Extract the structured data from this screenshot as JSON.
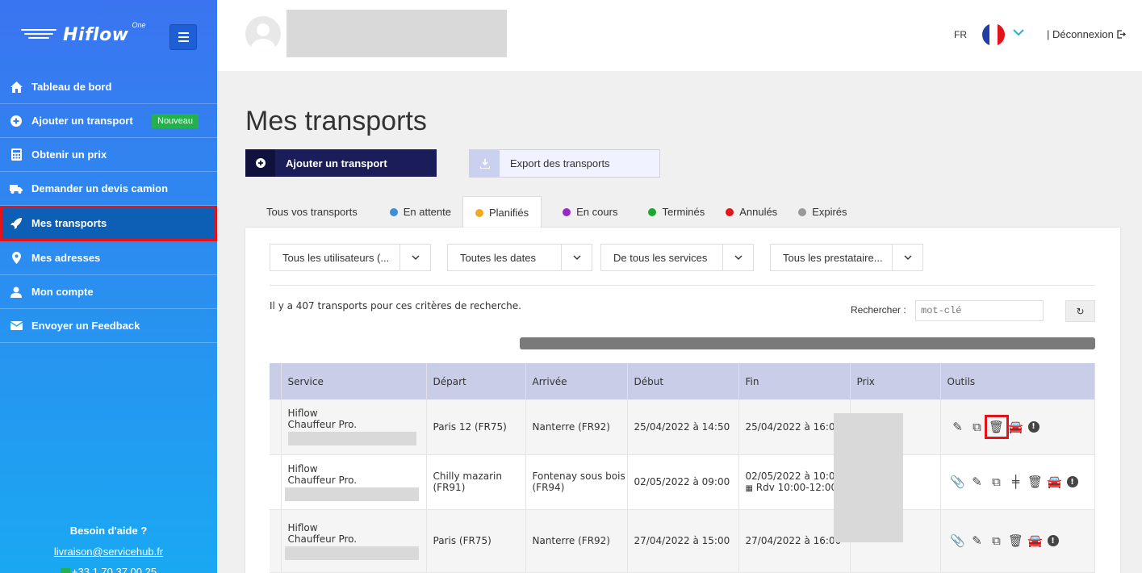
{
  "sidebar": {
    "logo_text": "Hiflow",
    "logo_sup": "One",
    "items": [
      {
        "label": "Tableau de bord",
        "icon": "home-icon"
      },
      {
        "label": "Ajouter un transport",
        "icon": "plus-circle-icon",
        "badge": "Nouveau"
      },
      {
        "label": "Obtenir un prix",
        "icon": "calculator-icon"
      },
      {
        "label": "Demander un devis camion",
        "icon": "truck-icon"
      },
      {
        "label": "Mes transports",
        "icon": "rocket-icon",
        "active": true
      },
      {
        "label": "Mes adresses",
        "icon": "map-pin-icon"
      },
      {
        "label": "Mon compte",
        "icon": "user-icon"
      },
      {
        "label": "Envoyer un Feedback",
        "icon": "envelope-icon"
      }
    ],
    "help_title": "Besoin d'aide ?",
    "help_email": "livraison@servicehub.fr",
    "help_phone": "+33 1 70 37 00 25"
  },
  "header": {
    "lang": "FR",
    "logout": "| Déconnexion"
  },
  "page": {
    "title": "Mes transports",
    "add_button": "Ajouter un transport",
    "export_button": "Export des transports"
  },
  "tabs": [
    {
      "label": "Tous vos transports",
      "color": ""
    },
    {
      "label": "En attente",
      "color": "#3a8fd6"
    },
    {
      "label": "Planifiés",
      "color": "#f5a623"
    },
    {
      "label": "En cours",
      "color": "#9b27c4"
    },
    {
      "label": "Terminés",
      "color": "#1aa82f"
    },
    {
      "label": "Annulés",
      "color": "#e3131b"
    },
    {
      "label": "Expirés",
      "color": "#999999"
    }
  ],
  "filters": [
    "Tous les utilisateurs (...",
    "Toutes les dates",
    "De tous les services",
    "Tous les prestataire..."
  ],
  "results": {
    "count_text": "Il y a 407 transports pour ces critères de recherche.",
    "search_label": "Rechercher :",
    "search_placeholder": "mot-clé"
  },
  "table": {
    "headers": [
      "Service",
      "Départ",
      "Arrivée",
      "Début",
      "Fin",
      "Prix",
      "Outils"
    ],
    "rows": [
      {
        "service1": "Hiflow",
        "service2": "Chauffeur Pro.",
        "depart": "Paris 12 (FR75)",
        "arrivee": "Nanterre (FR92)",
        "debut": "25/04/2022 à 14:50",
        "fin": "25/04/2022 à 16:00",
        "fin2": ""
      },
      {
        "service1": "Hiflow",
        "service2": "Chauffeur Pro.",
        "depart": "Chilly mazarin (FR91)",
        "arrivee": "Fontenay sous bois (FR94)",
        "debut": "02/05/2022 à 09:00",
        "fin": "02/05/2022 à 10:00",
        "fin2": "Rdv 10:00-12:00"
      },
      {
        "service1": "Hiflow",
        "service2": "Chauffeur Pro.",
        "depart": "Paris (FR75)",
        "arrivee": "Nanterre (FR92)",
        "debut": "27/04/2022 à 15:00",
        "fin": "27/04/2022 à 16:00",
        "fin2": ""
      }
    ]
  }
}
